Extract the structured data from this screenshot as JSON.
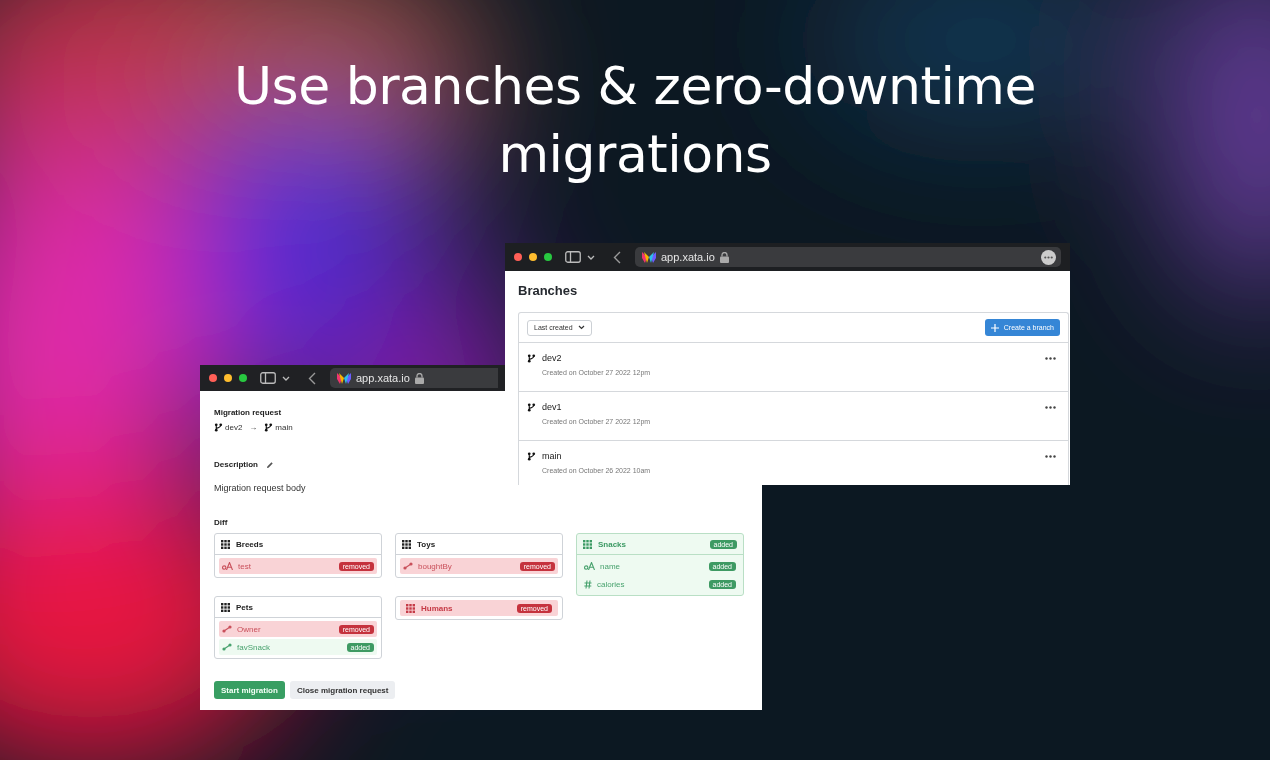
{
  "headline": [
    "Use branches & zero-downtime",
    "migrations"
  ],
  "migration_window": {
    "url": "app.xata.io",
    "heading": "Migration request",
    "source": "dev2",
    "arrow": "→",
    "target": "main",
    "description_label": "Description",
    "description": "Migration request body",
    "diff_label": "Diff",
    "diff_columns": [
      [
        {
          "name": "Breeds",
          "added": false,
          "removed": false,
          "fields": [
            {
              "name": "test",
              "kind": "text",
              "added": false,
              "removed": true,
              "badge": "removed"
            }
          ]
        },
        {
          "name": "Pets",
          "added": false,
          "removed": false,
          "fields": [
            {
              "name": "Owner",
              "kind": "link",
              "added": false,
              "removed": true,
              "badge": "removed"
            },
            {
              "name": "favSnack",
              "kind": "link",
              "added": true,
              "removed": false,
              "badge": "added"
            }
          ]
        }
      ],
      [
        {
          "name": "Toys",
          "added": false,
          "removed": false,
          "fields": [
            {
              "name": "boughtBy",
              "kind": "link",
              "added": false,
              "removed": true,
              "badge": "removed"
            }
          ]
        },
        {
          "name": "Humans",
          "added": false,
          "removed": true,
          "badge": "removed"
        }
      ],
      [
        {
          "name": "Snacks",
          "added": true,
          "removed": false,
          "badge": "added",
          "fields": [
            {
              "name": "name",
              "kind": "text",
              "added": true,
              "removed": false,
              "badge": "added"
            },
            {
              "name": "calories",
              "kind": "number",
              "added": true,
              "removed": false,
              "badge": "added"
            }
          ]
        }
      ]
    ],
    "buttons": [
      {
        "label": "Start migration",
        "kind": "primary"
      },
      {
        "label": "Close migration request",
        "kind": "secondary"
      }
    ]
  },
  "branches_window": {
    "url": "app.xata.io",
    "title": "Branches",
    "sort_button": "Last created",
    "create_button": "Create a branch",
    "branches": [
      {
        "name": "dev2",
        "created": "Created on October 27 2022 12pm"
      },
      {
        "name": "dev1",
        "created": "Created on October 27 2022 12pm"
      },
      {
        "name": "main",
        "created": "Created on October 26 2022 10am"
      }
    ]
  }
}
